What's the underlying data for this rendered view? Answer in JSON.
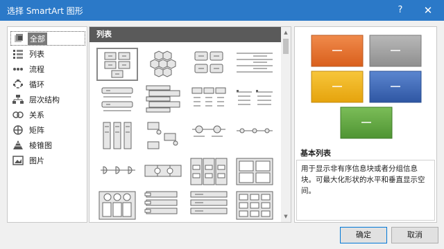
{
  "window": {
    "title": "选择 SmartArt 图形",
    "help": "?",
    "close": "✕"
  },
  "sidebar": {
    "items": [
      {
        "label": "全部",
        "icon": "all-icon"
      },
      {
        "label": "列表",
        "icon": "list-icon"
      },
      {
        "label": "流程",
        "icon": "process-icon"
      },
      {
        "label": "循环",
        "icon": "cycle-icon"
      },
      {
        "label": "层次结构",
        "icon": "hierarchy-icon"
      },
      {
        "label": "关系",
        "icon": "relationship-icon"
      },
      {
        "label": "矩阵",
        "icon": "matrix-icon"
      },
      {
        "label": "棱锥图",
        "icon": "pyramid-icon"
      },
      {
        "label": "图片",
        "icon": "picture-icon"
      }
    ]
  },
  "gallery": {
    "header": "列表"
  },
  "preview": {
    "title": "基本列表",
    "description": "用于显示非有序信息块或者分组信息块。可最大化形状的水平和垂直显示空间。",
    "colors": {
      "orange": "#e4712b",
      "gray": "#a0a0a0",
      "yellow": "#f0b71c",
      "blue": "#3a66b8",
      "green": "#62a843"
    }
  },
  "buttons": {
    "ok": "确定",
    "cancel": "取消"
  }
}
